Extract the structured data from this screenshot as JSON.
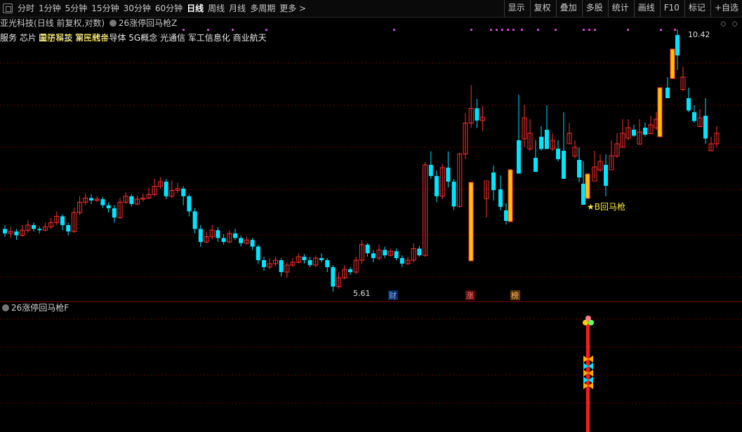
{
  "toolbar": {
    "periods": [
      "分时",
      "1分钟",
      "5分钟",
      "15分钟",
      "30分钟",
      "60分钟",
      "日线",
      "周线",
      "月线",
      "多周期",
      "更多 >"
    ],
    "active_period": "日线",
    "right_tools": [
      "显示",
      "复权",
      "叠加",
      "多股",
      "统计",
      "画线",
      "F10",
      "标记",
      "+自选"
    ]
  },
  "header": {
    "stock_name": "亚光科技",
    "chart_mode": "(日线 前复权,对数)",
    "indicator": "26涨停回马枪Z",
    "concepts": "服务 芯片 量子科技 第三代半导体 5G概念 光通信 军工信息化 商业航天",
    "concepts_overlay": "国防军工 军民融合"
  },
  "sub_panel": {
    "title": "26涨停回马枪F"
  },
  "markers": {
    "high_label": "10.42",
    "low_label": "5.61",
    "signal_label": "★B回马枪",
    "event_cai": "财",
    "event_zhang": "涨",
    "event_bang": "榜"
  },
  "colors": {
    "up": "#ff3030",
    "down": "#00e5ff",
    "bull_signal": "#ffc400",
    "grid": "#6a0000",
    "dot": "#d040d0"
  },
  "chart_data": {
    "type": "candlestick",
    "count": 86,
    "high": 10.42,
    "low": 5.61,
    "candles": [
      [
        6.52,
        6.45,
        6.58,
        6.4
      ],
      [
        6.45,
        6.48,
        6.55,
        6.38
      ],
      [
        6.48,
        6.42,
        6.52,
        6.35
      ],
      [
        6.42,
        6.5,
        6.58,
        6.4
      ],
      [
        6.5,
        6.58,
        6.66,
        6.46
      ],
      [
        6.58,
        6.52,
        6.62,
        6.48
      ],
      [
        6.52,
        6.5,
        6.56,
        6.45
      ],
      [
        6.5,
        6.55,
        6.62,
        6.48
      ],
      [
        6.55,
        6.62,
        6.7,
        6.52
      ],
      [
        6.62,
        6.72,
        6.8,
        6.58
      ],
      [
        6.72,
        6.58,
        6.75,
        6.5
      ],
      [
        6.58,
        6.48,
        6.62,
        6.42
      ],
      [
        6.48,
        6.78,
        6.86,
        6.46
      ],
      [
        6.78,
        6.95,
        7.05,
        6.74
      ],
      [
        6.95,
        7.02,
        7.1,
        6.9
      ],
      [
        7.02,
        6.98,
        7.08,
        6.92
      ],
      [
        6.98,
        7.0,
        7.05,
        6.95
      ],
      [
        7.0,
        6.9,
        7.04,
        6.86
      ],
      [
        6.9,
        6.85,
        6.95,
        6.78
      ],
      [
        6.85,
        6.7,
        6.9,
        6.62
      ],
      [
        6.7,
        6.95,
        7.02,
        6.68
      ],
      [
        6.95,
        7.05,
        7.12,
        6.92
      ],
      [
        7.05,
        6.92,
        7.08,
        6.88
      ],
      [
        6.92,
        7.0,
        7.06,
        6.9
      ],
      [
        7.0,
        7.02,
        7.1,
        6.96
      ],
      [
        7.02,
        7.08,
        7.2,
        7.0
      ],
      [
        7.08,
        7.22,
        7.35,
        7.05
      ],
      [
        7.22,
        7.3,
        7.38,
        7.18
      ],
      [
        7.3,
        7.05,
        7.35,
        7.0
      ],
      [
        7.05,
        7.15,
        7.32,
        7.02
      ],
      [
        7.15,
        7.18,
        7.28,
        7.1
      ],
      [
        7.18,
        7.05,
        7.22,
        6.9
      ],
      [
        7.05,
        6.8,
        7.08,
        6.72
      ],
      [
        6.8,
        6.52,
        6.85,
        6.45
      ],
      [
        6.52,
        6.32,
        6.58,
        6.25
      ],
      [
        6.32,
        6.4,
        6.48,
        6.3
      ],
      [
        6.4,
        6.5,
        6.58,
        6.36
      ],
      [
        6.5,
        6.38,
        6.55,
        6.32
      ],
      [
        6.38,
        6.32,
        6.44,
        6.28
      ],
      [
        6.32,
        6.45,
        6.5,
        6.3
      ],
      [
        6.45,
        6.38,
        6.52,
        6.35
      ],
      [
        6.38,
        6.3,
        6.42,
        6.25
      ],
      [
        6.3,
        6.35,
        6.4,
        6.28
      ],
      [
        6.35,
        6.25,
        6.38,
        6.2
      ],
      [
        6.25,
        6.05,
        6.28,
        6.0
      ],
      [
        6.05,
        5.95,
        6.1,
        5.9
      ],
      [
        5.95,
        6.0,
        6.08,
        5.92
      ],
      [
        6.0,
        6.05,
        6.1,
        5.96
      ],
      [
        6.05,
        5.88,
        6.08,
        5.82
      ],
      [
        5.88,
        5.98,
        6.02,
        5.8
      ],
      [
        5.98,
        6.02,
        6.08,
        5.95
      ],
      [
        6.02,
        6.1,
        6.15,
        6.0
      ],
      [
        6.1,
        6.05,
        6.14,
        6.0
      ],
      [
        6.05,
        5.98,
        6.1,
        5.95
      ],
      [
        5.98,
        6.08,
        6.12,
        5.95
      ],
      [
        6.08,
        6.05,
        6.15,
        6.02
      ],
      [
        6.05,
        5.95,
        6.08,
        5.88
      ],
      [
        5.95,
        5.68,
        5.98,
        5.61
      ],
      [
        5.68,
        5.8,
        5.88,
        5.65
      ],
      [
        5.8,
        5.92,
        5.98,
        5.78
      ],
      [
        5.92,
        5.88,
        5.95,
        5.84
      ],
      [
        5.88,
        6.05,
        6.1,
        5.85
      ],
      [
        6.05,
        6.28,
        6.35,
        6.0
      ],
      [
        6.28,
        6.15,
        6.3,
        6.1
      ],
      [
        6.15,
        6.08,
        6.2,
        6.02
      ],
      [
        6.08,
        6.2,
        6.28,
        6.05
      ],
      [
        6.2,
        6.12,
        6.25,
        6.08
      ],
      [
        6.12,
        6.18,
        6.22,
        6.1
      ],
      [
        6.18,
        6.08,
        6.22,
        6.05
      ],
      [
        6.08,
        6.0,
        6.12,
        5.95
      ],
      [
        6.0,
        6.05,
        6.1,
        5.98
      ],
      [
        6.05,
        6.22,
        6.3,
        6.02
      ],
      [
        6.22,
        6.12,
        6.26,
        6.1
      ],
      [
        6.12,
        7.6,
        7.65,
        6.1
      ],
      [
        7.6,
        7.4,
        7.85,
        7.35
      ],
      [
        7.4,
        7.05,
        7.5,
        6.95
      ],
      [
        7.05,
        7.55,
        7.62,
        7.0
      ],
      [
        7.55,
        7.3,
        7.85,
        7.2
      ],
      [
        7.3,
        6.88,
        7.35,
        6.82
      ],
      [
        6.88,
        7.8,
        7.82,
        6.86
      ],
      [
        7.8,
        8.4,
        8.6,
        7.7
      ],
      [
        8.4,
        8.7,
        9.2,
        8.3
      ],
      [
        8.7,
        8.45,
        8.9,
        8.3
      ],
      [
        8.45,
        8.52,
        8.75,
        8.25
      ]
    ]
  }
}
